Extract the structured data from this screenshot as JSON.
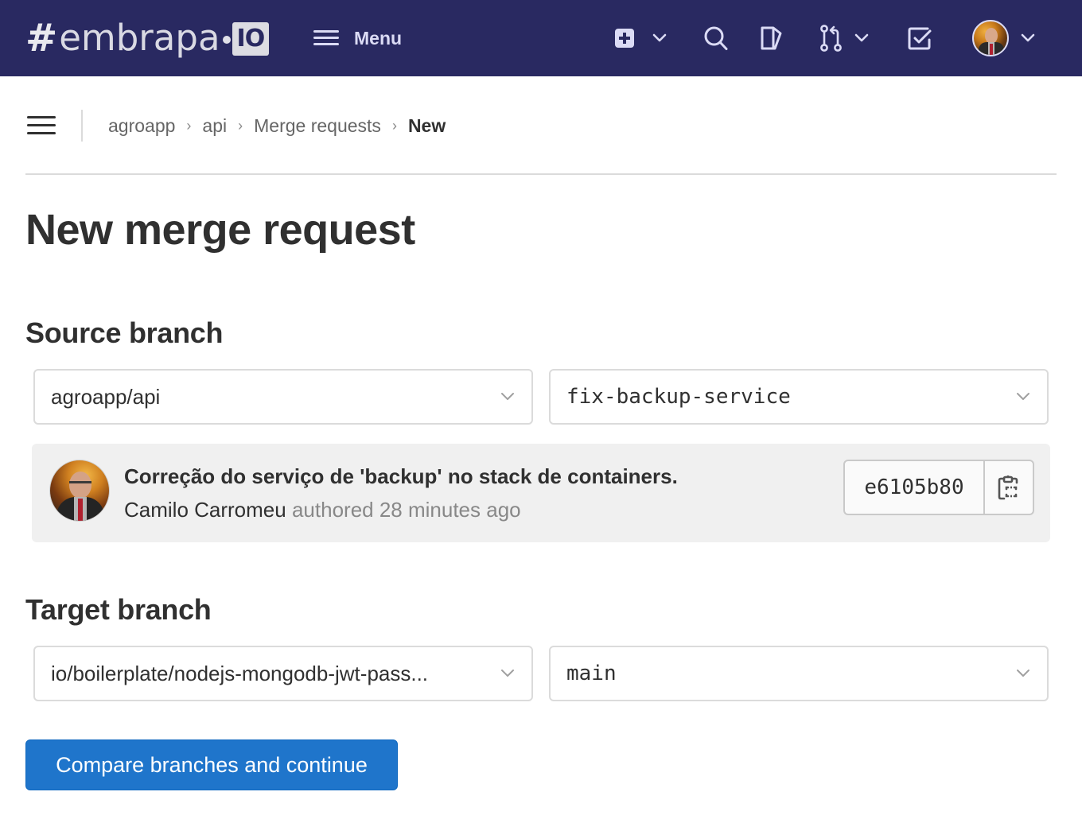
{
  "navbar": {
    "logo": {
      "hash": "#",
      "word": "embrapa",
      "badge": "IO"
    },
    "menu_label": "Menu",
    "icons": {
      "create": "plus-square-icon",
      "search": "search-icon",
      "issues": "issues-icon",
      "merge_requests": "merge-request-icon",
      "todos": "todo-checkbox-icon",
      "user": "user-avatar"
    },
    "colors": {
      "background": "#292961",
      "foreground": "#dbdbf5"
    }
  },
  "breadcrumb": {
    "items": [
      {
        "label": "agroapp"
      },
      {
        "label": "api"
      },
      {
        "label": "Merge requests"
      },
      {
        "label": "New"
      }
    ],
    "separator": "›"
  },
  "page": {
    "title": "New merge request"
  },
  "source": {
    "heading": "Source branch",
    "project": "agroapp/api",
    "branch": "fix-backup-service",
    "commit": {
      "title": "Correção do serviço de 'backup' no stack de containers.",
      "author": "Camilo Carromeu",
      "time_text": "authored 28 minutes ago",
      "sha": "e6105b80",
      "copy_icon": "copy-to-clipboard-icon"
    }
  },
  "target": {
    "heading": "Target branch",
    "project": "io/boilerplate/nodejs-mongodb-jwt-pass...",
    "branch": "main"
  },
  "actions": {
    "compare_label": "Compare branches and continue",
    "primary_color": "#1f75cb"
  }
}
